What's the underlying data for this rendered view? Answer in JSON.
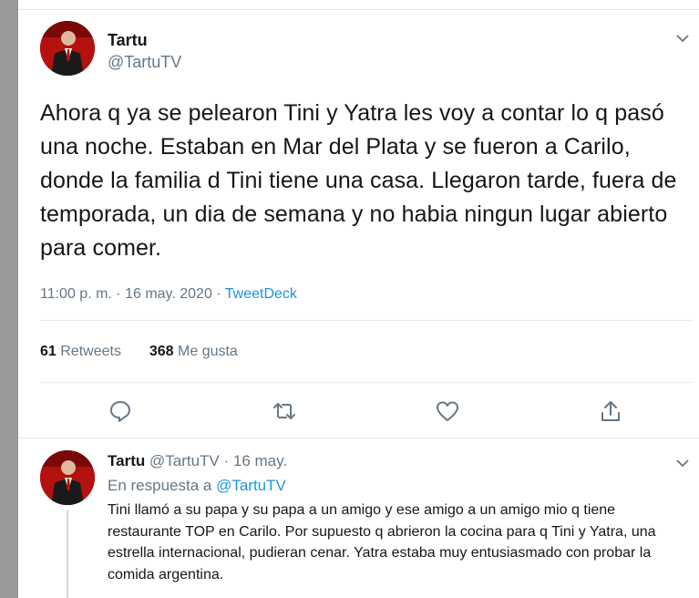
{
  "tweet": {
    "author_name": "Tartu",
    "author_handle": "@TartuTV",
    "text": "Ahora q ya se pelearon Tini y Yatra les voy a contar lo q pasó una noche. Estaban en Mar del Plata y se fueron a Carilo, donde la familia d Tini tiene una casa. Llegaron tarde, fuera de temporada, un dia de semana y no habia ningun lugar abierto para comer.",
    "time": "11:00 p. m. · 16 may. 2020 · ",
    "source": "TweetDeck",
    "retweets_count": "61",
    "retweets_label": "Retweets",
    "likes_count": "368",
    "likes_label": "Me gusta"
  },
  "actions": [
    "reply-icon",
    "retweet-icon",
    "like-icon",
    "share-icon"
  ],
  "reply": {
    "author_name": "Tartu",
    "author_handle_date": "@TartuTV · 16 may.",
    "in_reply_prefix": "En respuesta a ",
    "in_reply_handle": "@TartuTV",
    "text": "Tini llamó a su papa y su papa a un amigo y ese amigo a un amigo mio q tiene restaurante TOP en Carilo. Por supuesto q abrieron la cocina para q Tini y Yatra, una estrella internacional, pudieran cenar. Yatra estaba muy entusiasmado con probar la comida argentina."
  },
  "colors": {
    "link": "#1b95e0",
    "secondary_text": "#657786",
    "primary_text": "#14171a",
    "avatar_bg": "#b3120e"
  }
}
